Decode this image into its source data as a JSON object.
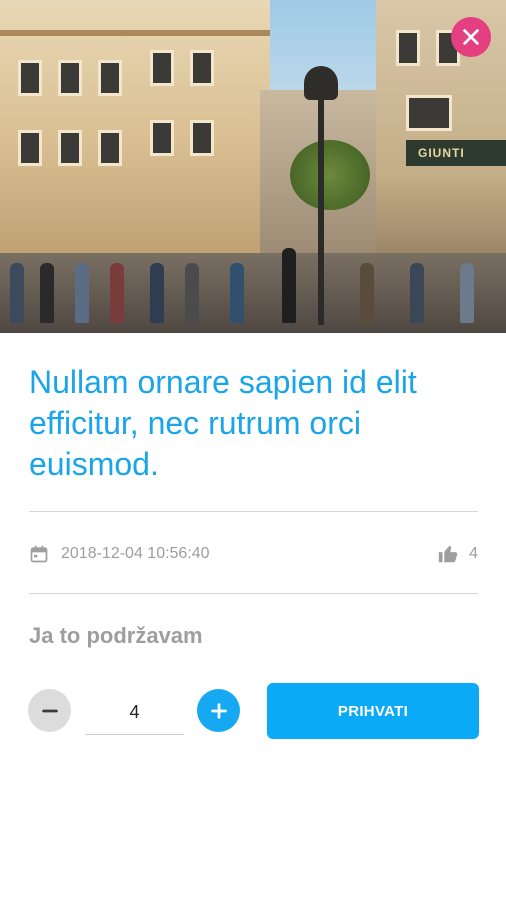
{
  "hero": {
    "image_alt": "City pedestrian street with historic buildings",
    "shop_sign": "GIUNTI",
    "close_icon": "close-icon"
  },
  "article": {
    "title": "Nullam ornare sapien id elit efficitur, nec rutrum orci euismod.",
    "date": "2018-12-04 10:56:40",
    "like_count": "4"
  },
  "support": {
    "label": "Ja to podržavam",
    "quantity": "4",
    "accept_label": "PRIHVATI"
  },
  "colors": {
    "accent": "#1aa5ea",
    "close": "#e43f80",
    "button": "#0aaaf7",
    "muted": "#9e9e9e"
  }
}
